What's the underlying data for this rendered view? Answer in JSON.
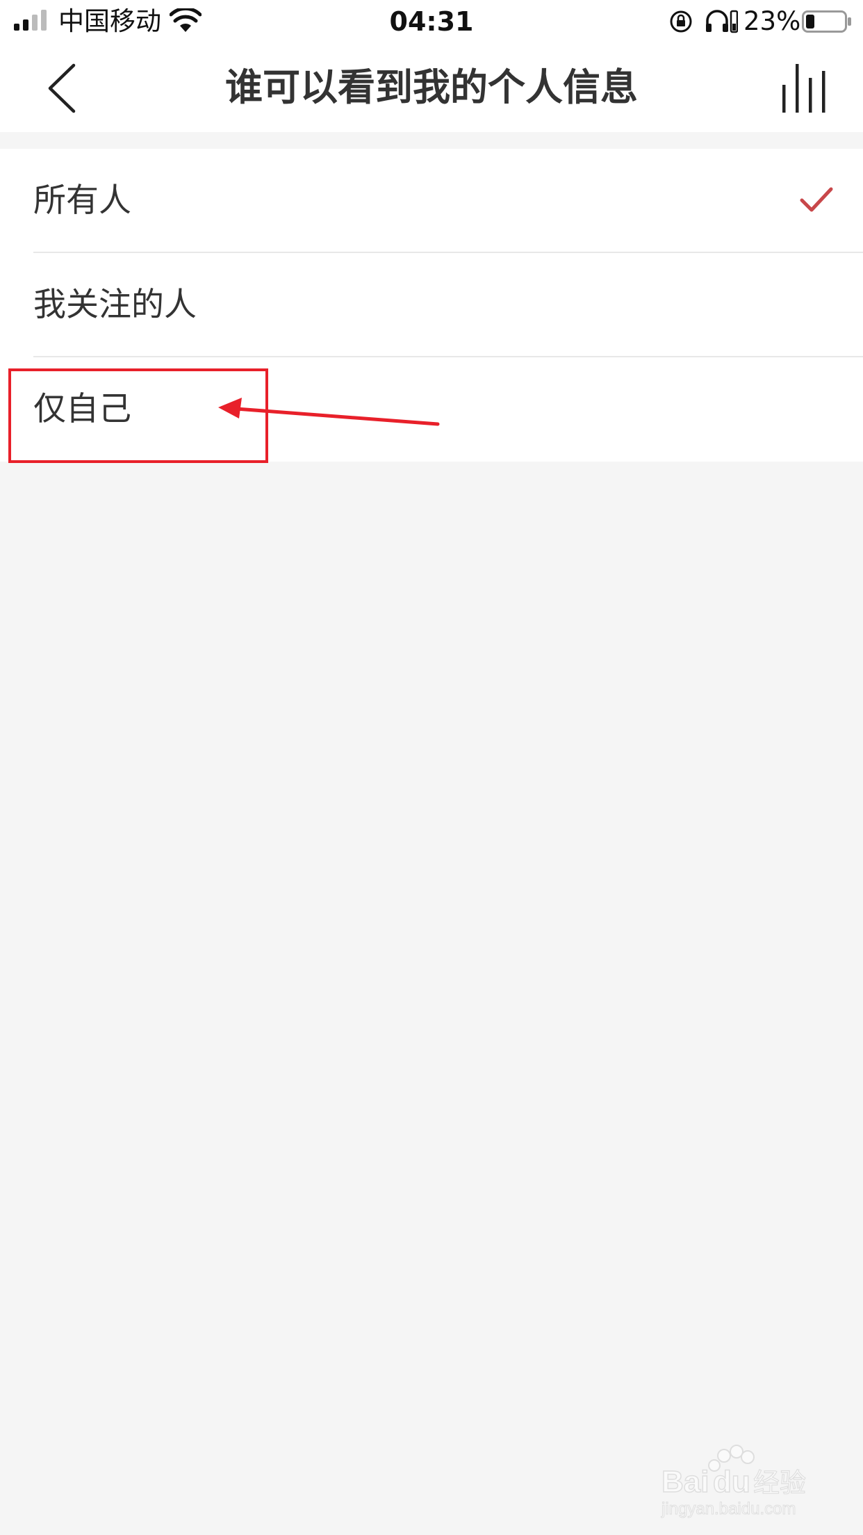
{
  "status_bar": {
    "carrier": "中国移动",
    "time": "04:31",
    "battery_percent": "23%"
  },
  "nav": {
    "title": "谁可以看到我的个人信息",
    "back_icon": "chevron-left-icon",
    "right_icon": "equalizer-bars-icon"
  },
  "options": [
    {
      "label": "所有人",
      "selected": true
    },
    {
      "label": "我关注的人",
      "selected": false
    },
    {
      "label": "仅自己",
      "selected": false
    }
  ],
  "colors": {
    "check": "#c8474a",
    "annotation": "#e8202a",
    "background": "#f5f5f5"
  },
  "watermark": {
    "brand": "Baidu经验",
    "url": "jingyan.baidu.com"
  }
}
